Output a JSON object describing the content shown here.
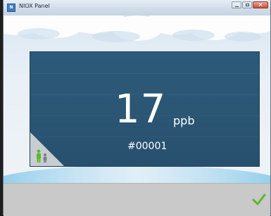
{
  "window": {
    "title": "NIOX Panel",
    "icon_label": "N"
  },
  "measurement": {
    "value": "17",
    "unit": "ppb",
    "sample_id": "#00001"
  },
  "colors": {
    "panel": "#2b5674",
    "accent_green": "#5cb82e",
    "bottom_bar": "#c9c9c9"
  },
  "icons": {
    "mode": "adult-child-people-icon",
    "confirm": "checkmark-icon"
  }
}
